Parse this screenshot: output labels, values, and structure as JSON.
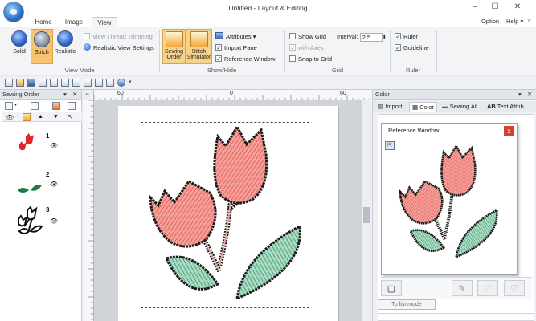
{
  "window": {
    "title": "Untitled - Layout & Editing",
    "controls": {
      "minimize": "–",
      "maximize": "☐",
      "close": "✕"
    }
  },
  "tabs": [
    {
      "label": "Home"
    },
    {
      "label": "Image"
    },
    {
      "label": "View",
      "active": true
    }
  ],
  "topright": {
    "option": "Option",
    "help": "Help"
  },
  "ribbon": {
    "view_mode": {
      "label": "View Mode",
      "solid": "Solid",
      "stitch": "Stitch",
      "realistic": "Realistic",
      "view_thread_trimming": "View Thread Trimming",
      "realistic_view_settings": "Realistic View Settings"
    },
    "show_hide": {
      "label": "Show/Hide",
      "sewing_order_line1": "Sewing",
      "sewing_order_line2": "Order",
      "stitch_sim_line1": "Stitch",
      "stitch_sim_line2": "Simulator",
      "attributes": "Attributes",
      "import_pane": "Import Pane",
      "reference_window": "Reference Window"
    },
    "grid": {
      "label": "Grid",
      "show_grid": "Show Grid",
      "interval_label": "Interval:",
      "interval_value": "2.5",
      "with_axes": "with Axes",
      "snap_to_grid": "Snap to Grid"
    },
    "ruler": {
      "label": "Ruler",
      "ruler": "Ruler",
      "guideline": "Guideline"
    }
  },
  "sewing_order": {
    "title": "Sewing Order",
    "items": [
      {
        "num": "1"
      },
      {
        "num": "2"
      },
      {
        "num": "3"
      }
    ]
  },
  "rulers": {
    "h_left": "60",
    "h_zero": "0",
    "h_right": "60"
  },
  "color_pane": {
    "title": "Color",
    "tabs": {
      "import": "Import",
      "color": "Color",
      "sewing_attr": "Sewing At...",
      "text_attr": "Text Attrib..."
    },
    "reference_window": {
      "title": "Reference Window",
      "close": "x"
    },
    "to_list_mode": "To list mode"
  },
  "colors": {
    "petal": "#e8665e",
    "petal_light": "#f3a19a",
    "leaf": "#2e8a5f",
    "leaf_light": "#8fcfb0",
    "stitch_dark": "#1a1a1a",
    "accent_ribbon": "#f6c46f"
  }
}
